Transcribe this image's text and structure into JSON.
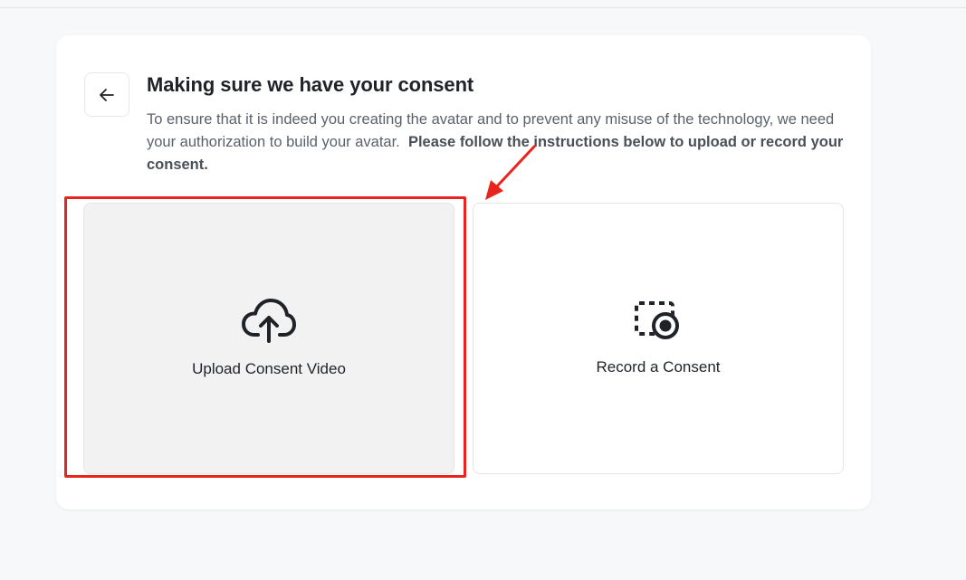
{
  "page": {
    "title": "Making sure we have your consent",
    "description_part1": "To ensure that it is indeed you creating the avatar and to prevent any misuse of the technology, we need your authorization to build your avatar.",
    "description_bold": "Please follow the instructions below to upload or record your consent."
  },
  "options": {
    "upload": {
      "label": "Upload Consent Video",
      "icon": "cloud-upload-icon"
    },
    "record": {
      "label": "Record a Consent",
      "icon": "record-icon"
    }
  },
  "colors": {
    "annotation": "#e8241c",
    "selected_option_bg": "#f2f2f2",
    "text": "#1f2328"
  }
}
